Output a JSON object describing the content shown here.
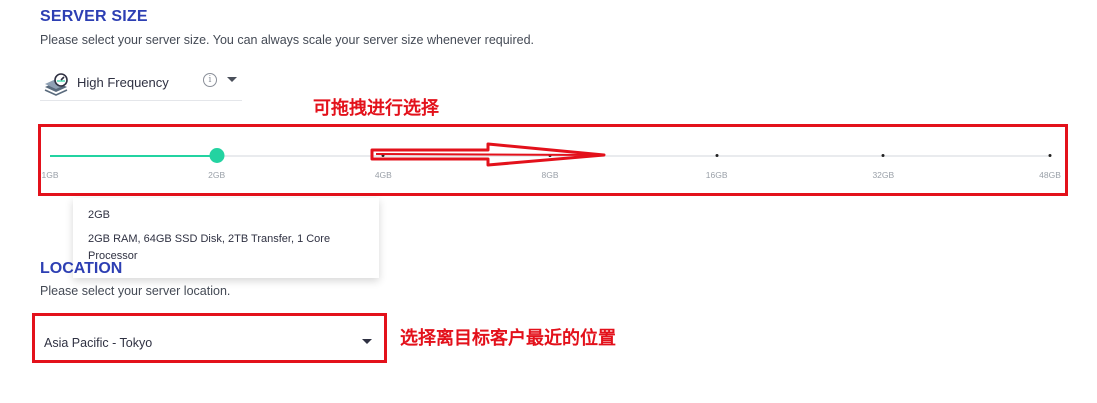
{
  "server_size": {
    "title": "SERVER SIZE",
    "subtitle": "Please select your server size. You can always scale your server size whenever required.",
    "plan_type": "High Frequency",
    "plan_icon": "stack-speed-icon",
    "info_icon": "i"
  },
  "annotations": {
    "drag_hint": "可拖拽进行选择",
    "location_hint": "选择离目标客户最近的位置",
    "color": "#e3111b"
  },
  "slider": {
    "options": [
      "1GB",
      "2GB",
      "4GB",
      "8GB",
      "16GB",
      "32GB",
      "48GB"
    ],
    "selected": "2GB",
    "selected_index": 1,
    "accent": "#23d3a1"
  },
  "tooltip": {
    "name": "2GB",
    "description": "2GB RAM, 64GB SSD Disk, 2TB Transfer, 1 Core Processor"
  },
  "location": {
    "title": "LOCATION",
    "subtitle": "Please select your server location.",
    "value": "Asia Pacific - Tokyo"
  }
}
